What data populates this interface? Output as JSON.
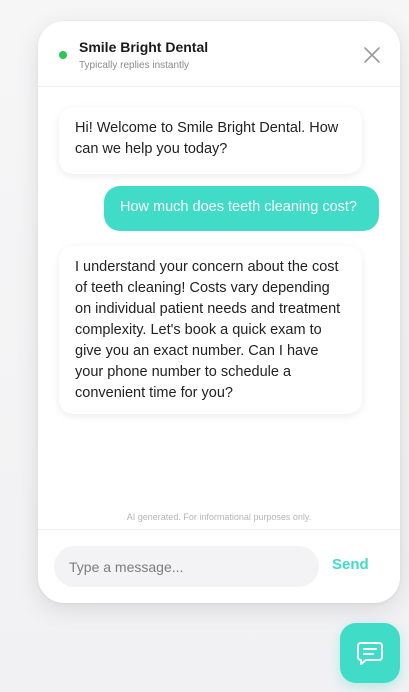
{
  "header": {
    "title": "Smile Bright Dental",
    "subtitle": "Typically replies instantly",
    "status": "online",
    "close_icon": "close-icon"
  },
  "messages": [
    {
      "sender": "bot",
      "text": "Hi! Welcome to Smile Bright Dental. How can we help you today?"
    },
    {
      "sender": "user",
      "text": "How much does teeth cleaning cost?"
    },
    {
      "sender": "bot",
      "text": "I understand your concern about the cost of teeth cleaning! Costs vary depending on individual patient needs and treatment complexity. Let's book a quick exam to give you an exact number. Can I have your phone number to schedule a convenient time for you?"
    }
  ],
  "disclaimer": "AI generated. For informational purposes only.",
  "composer": {
    "placeholder": "Type a message...",
    "value": "",
    "send_label": "Send"
  },
  "launcher": {
    "icon": "chat-bubble-icon"
  },
  "colors": {
    "accent": "#40dcc8",
    "status": "#2dc653"
  }
}
